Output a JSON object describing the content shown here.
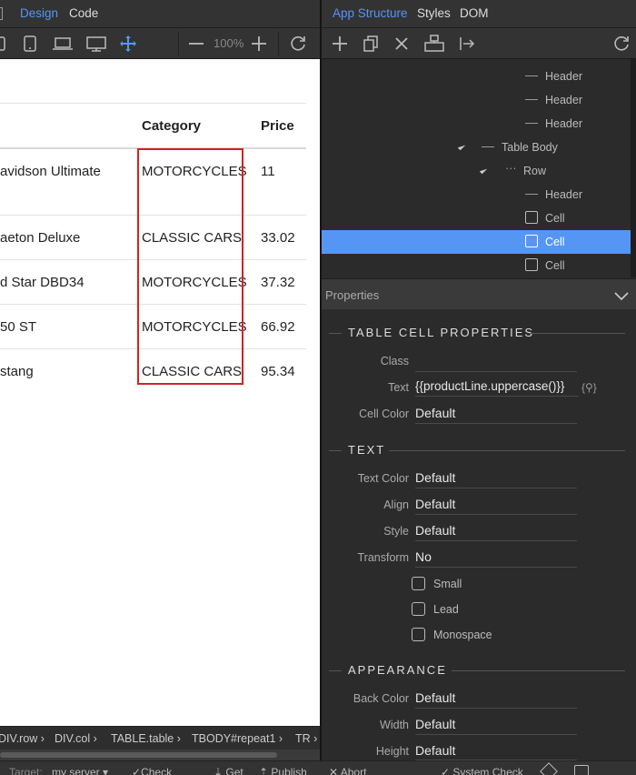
{
  "left_tabs": {
    "design": "Design",
    "code": "Code"
  },
  "left_toolbar": {
    "zoom": "100%"
  },
  "table": {
    "headers": [
      "Category",
      "Price"
    ],
    "rows": [
      {
        "name": "avidson Ultimate",
        "category": "MOTORCYCLES",
        "price": "11"
      },
      {
        "name": "aeton Deluxe",
        "category": "CLASSIC CARS",
        "price": "33.02"
      },
      {
        "name": "d Star DBD34",
        "category": "MOTORCYCLES",
        "price": "37.32"
      },
      {
        "name": "50 ST",
        "category": "MOTORCYCLES",
        "price": "66.92"
      },
      {
        "name": "stang",
        "category": "CLASSIC CARS",
        "price": "95.34"
      }
    ]
  },
  "breadcrumb": [
    "DIV.row ›",
    "DIV.col ›",
    "TABLE.table ›",
    "TBODY#repeat1 ›",
    "TR ›"
  ],
  "statusbar": [
    "Target:",
    "my server ▾",
    "✓Check",
    "⇣ Get",
    "⇡ Publish",
    "✕ Abort",
    "✓ System Check"
  ],
  "right_tabs": {
    "app_structure": "App Structure",
    "styles": "Styles",
    "dom": "DOM"
  },
  "tree": [
    {
      "label": "Header",
      "kind": "dash"
    },
    {
      "label": "Header",
      "kind": "dash"
    },
    {
      "label": "Header",
      "kind": "dash"
    },
    {
      "label": "Table Body",
      "kind": "dash-tri"
    },
    {
      "label": "Row",
      "kind": "dots-tri"
    },
    {
      "label": "Header",
      "kind": "dash"
    },
    {
      "label": "Cell",
      "kind": "box"
    },
    {
      "label": "Cell",
      "kind": "box",
      "selected": true
    },
    {
      "label": "Cell",
      "kind": "box"
    }
  ],
  "properties": {
    "title": "Properties",
    "sections": {
      "table_cell": "TABLE CELL PROPERTIES",
      "text": "TEXT",
      "appearance": "APPEARANCE"
    },
    "class_label": "Class",
    "text_label": "Text",
    "text_value": "{{productLine.uppercase()}}",
    "dyn_icon": "{⚲}",
    "cell_color_label": "Cell Color",
    "cell_color_value": "Default",
    "text_color_label": "Text Color",
    "text_color_value": "Default",
    "align_label": "Align",
    "align_value": "Default",
    "style_label": "Style",
    "style_value": "Default",
    "transform_label": "Transform",
    "transform_value": "No",
    "small": "Small",
    "lead": "Lead",
    "monospace": "Monospace",
    "back_color_label": "Back Color",
    "back_color_value": "Default",
    "width_label": "Width",
    "width_value": "Default",
    "height_label": "Height",
    "height_value": "Default"
  },
  "colors": {
    "accent": "#5596f5",
    "selection_border": "#d32222"
  }
}
